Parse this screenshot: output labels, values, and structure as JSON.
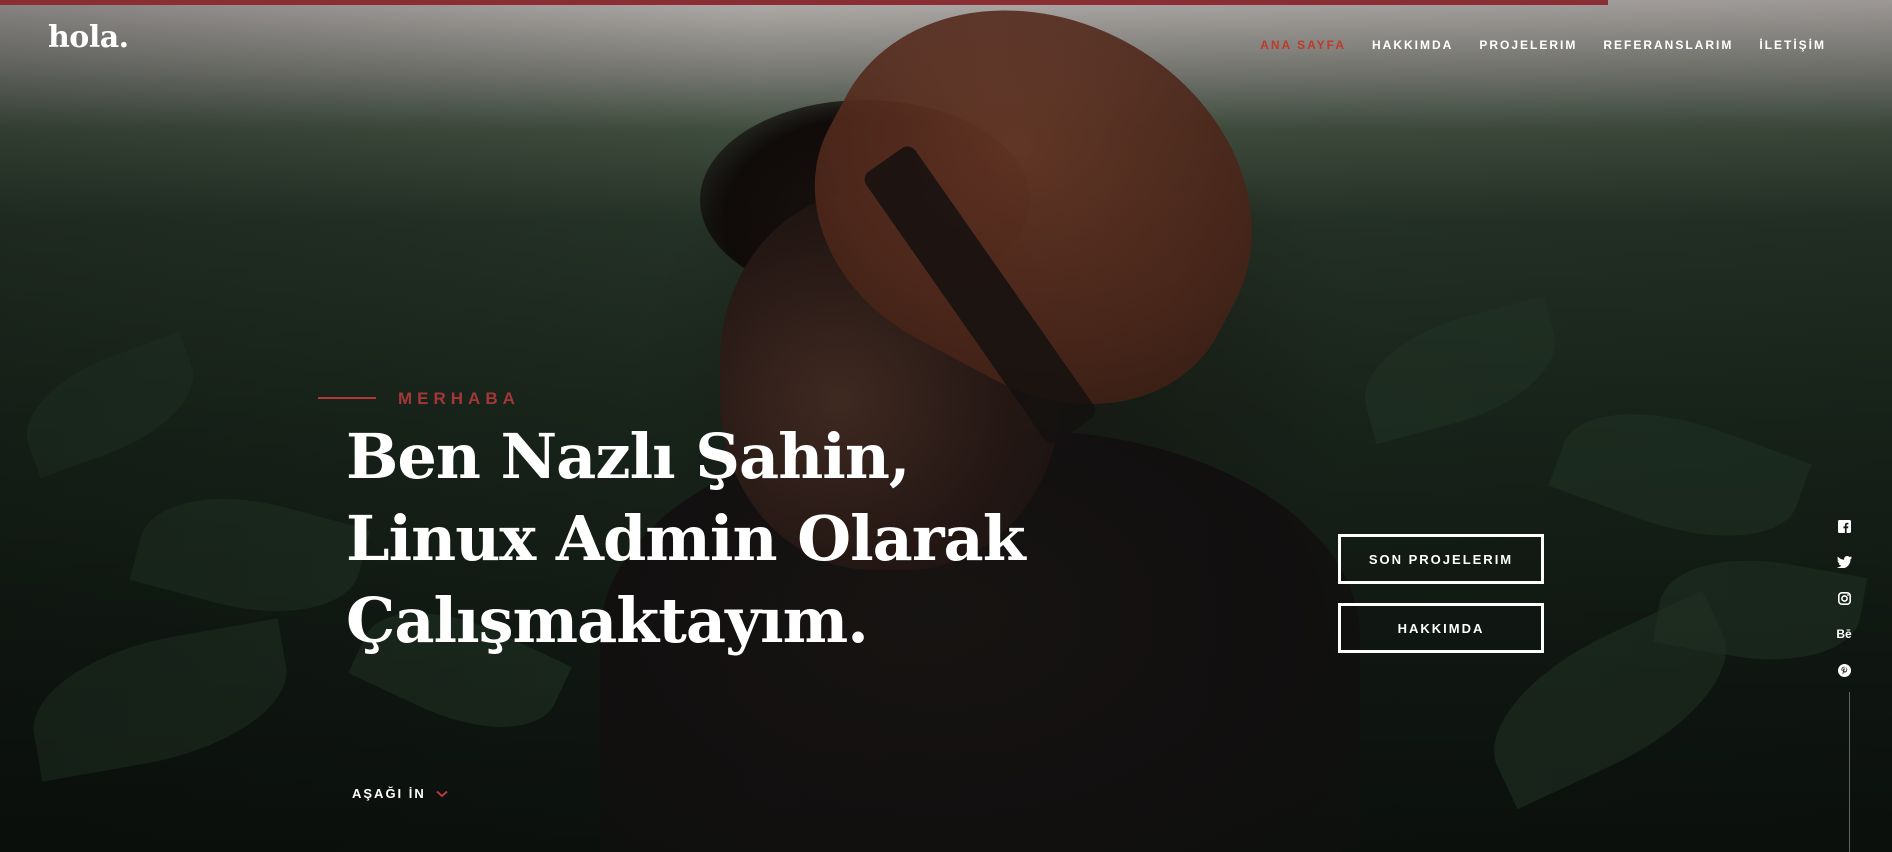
{
  "brand": {
    "logo": "hola.",
    "accent_color": "#b03a3a"
  },
  "nav": {
    "items": [
      {
        "label": "ANA SAYFA",
        "active": true
      },
      {
        "label": "HAKKIMDA",
        "active": false
      },
      {
        "label": "PROJELERIM",
        "active": false
      },
      {
        "label": "REFERANSLARIM",
        "active": false
      },
      {
        "label": "İLETİŞİM",
        "active": false
      }
    ]
  },
  "hero": {
    "subtitle": "MERHABA",
    "headline": "Ben Nazlı Şahin, Linux Admin Olarak Çalışmaktayım.",
    "buttons": {
      "projects": "SON PROJELERIM",
      "about": "HAKKIMDA"
    },
    "scroll_label": "AŞAĞI İN"
  },
  "social": {
    "icons": [
      "facebook-icon",
      "twitter-icon",
      "instagram-icon",
      "behance-icon",
      "pinterest-icon"
    ],
    "behance_text": "Bē"
  }
}
